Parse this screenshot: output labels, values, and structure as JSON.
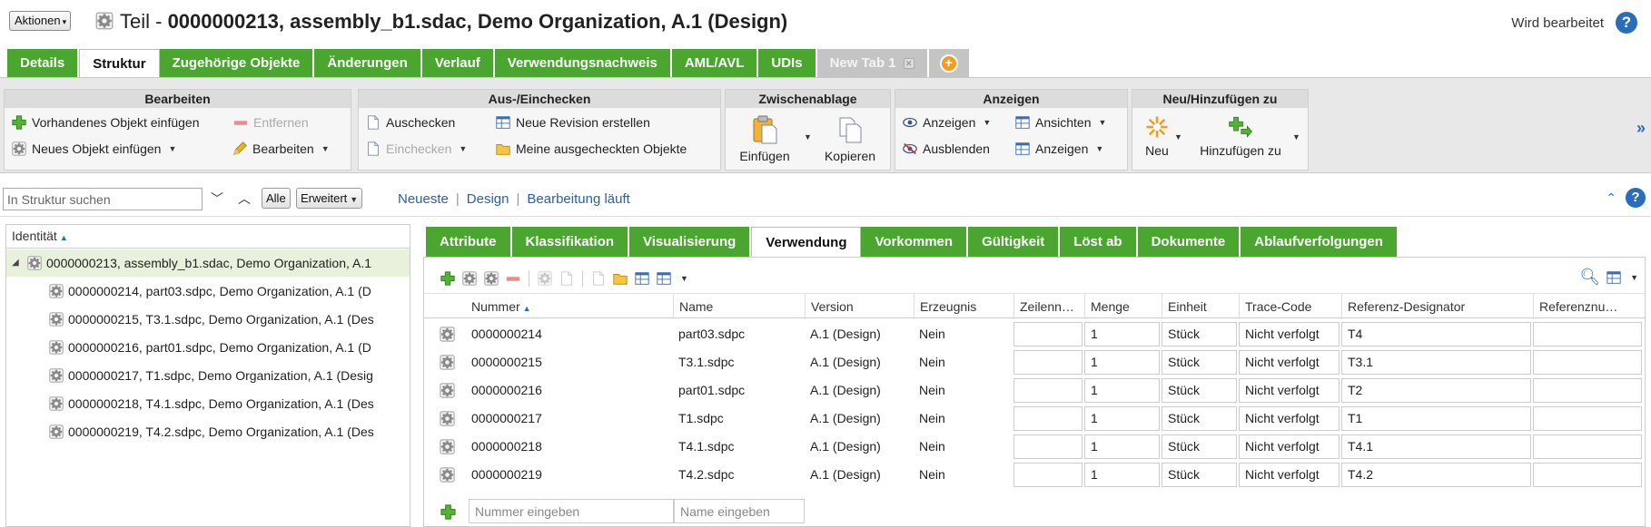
{
  "titlebar": {
    "actions_label": "Aktionen",
    "title_prefix": "Teil - ",
    "title_main": "0000000213, assembly_b1.sdac, Demo Organization, A.1 (Design)",
    "status": "Wird bearbeitet",
    "help": "?"
  },
  "main_tabs": [
    {
      "label": "Details",
      "active": false
    },
    {
      "label": "Struktur",
      "active": true
    },
    {
      "label": "Zugehörige Objekte",
      "active": false
    },
    {
      "label": "Änderungen",
      "active": false
    },
    {
      "label": "Verlauf",
      "active": false
    },
    {
      "label": "Verwendungsnachweis",
      "active": false
    },
    {
      "label": "AML/AVL",
      "active": false
    },
    {
      "label": "UDIs",
      "active": false
    },
    {
      "label": "New Tab 1",
      "active": false
    }
  ],
  "ribbon": {
    "bearbeiten": {
      "title": "Bearbeiten",
      "insert_existing": "Vorhandenes Objekt einfügen",
      "remove": "Entfernen",
      "insert_new": "Neues Objekt einfügen",
      "edit": "Bearbeiten"
    },
    "checkin": {
      "title": "Aus-/Einchecken",
      "checkout": "Auschecken",
      "new_revision": "Neue Revision erstellen",
      "checkin": "Einchecken",
      "my_checked_out": "Meine ausgecheckten Objekte"
    },
    "clipboard": {
      "title": "Zwischenablage",
      "paste": "Einfügen",
      "copy": "Kopieren"
    },
    "view": {
      "title": "Anzeigen",
      "show": "Anzeigen",
      "views": "Ansichten",
      "hide": "Ausblenden",
      "display": "Anzeigen"
    },
    "new_add": {
      "title": "Neu/Hinzufügen zu",
      "new": "Neu",
      "add_to": "Hinzufügen zu"
    },
    "more": "»"
  },
  "searchbar": {
    "placeholder": "In Struktur suchen",
    "all_label": "Alle",
    "advanced_label": "Erweitert",
    "filters": [
      "Neueste",
      "Design",
      "Bearbeitung läuft"
    ]
  },
  "tree": {
    "header": "Identität",
    "root": "0000000213, assembly_b1.sdac, Demo Organization, A.1",
    "children": [
      "0000000214, part03.sdpc, Demo Organization, A.1 (D",
      "0000000215, T3.1.sdpc, Demo Organization, A.1 (Des",
      "0000000216, part01.sdpc, Demo Organization, A.1 (D",
      "0000000217, T1.sdpc, Demo Organization, A.1 (Desig",
      "0000000218, T4.1.sdpc, Demo Organization, A.1 (Des",
      "0000000219, T4.2.sdpc, Demo Organization, A.1 (Des"
    ]
  },
  "sub_tabs": [
    {
      "label": "Attribute",
      "active": false
    },
    {
      "label": "Klassifikation",
      "active": false
    },
    {
      "label": "Visualisierung",
      "active": false
    },
    {
      "label": "Verwendung",
      "active": true
    },
    {
      "label": "Vorkommen",
      "active": false
    },
    {
      "label": "Gültigkeit",
      "active": false
    },
    {
      "label": "Löst ab",
      "active": false
    },
    {
      "label": "Dokumente",
      "active": false
    },
    {
      "label": "Ablaufverfolgungen",
      "active": false
    }
  ],
  "grid": {
    "columns": [
      "Nummer",
      "Name",
      "Version",
      "Erzeugnis",
      "Zeilenn…",
      "Menge",
      "Einheit",
      "Trace-Code",
      "Referenz-Designator",
      "Referenznu…"
    ],
    "rows": [
      [
        "0000000214",
        "part03.sdpc",
        "A.1 (Design)",
        "Nein",
        "",
        "1",
        "Stück",
        "Nicht verfolgt",
        "T4",
        ""
      ],
      [
        "0000000215",
        "T3.1.sdpc",
        "A.1 (Design)",
        "Nein",
        "",
        "1",
        "Stück",
        "Nicht verfolgt",
        "T3.1",
        ""
      ],
      [
        "0000000216",
        "part01.sdpc",
        "A.1 (Design)",
        "Nein",
        "",
        "1",
        "Stück",
        "Nicht verfolgt",
        "T2",
        ""
      ],
      [
        "0000000217",
        "T1.sdpc",
        "A.1 (Design)",
        "Nein",
        "",
        "1",
        "Stück",
        "Nicht verfolgt",
        "T1",
        ""
      ],
      [
        "0000000218",
        "T4.1.sdpc",
        "A.1 (Design)",
        "Nein",
        "",
        "1",
        "Stück",
        "Nicht verfolgt",
        "T4.1",
        ""
      ],
      [
        "0000000219",
        "T4.2.sdpc",
        "A.1 (Design)",
        "Nein",
        "",
        "1",
        "Stück",
        "Nicht verfolgt",
        "T4.2",
        ""
      ]
    ],
    "new_row": {
      "number_placeholder": "Nummer eingeben",
      "name_placeholder": "Name eingeben"
    }
  },
  "colors": {
    "tab_green": "#4aa62f",
    "link_blue": "#2a5fa8",
    "ribbon_bg": "#e8e8e8",
    "selected_row": "#e7f1dc"
  }
}
